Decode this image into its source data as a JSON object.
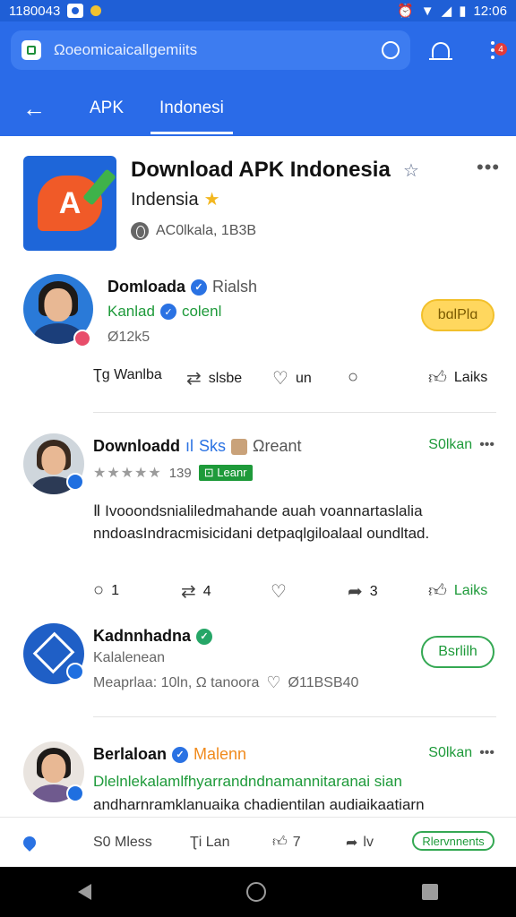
{
  "status_bar": {
    "time_left": "1180043",
    "time_right": "12:06"
  },
  "header": {
    "search_text": "Ωoeomicaicallgemiits",
    "notification_count": "4",
    "tabs": [
      {
        "label": "APK"
      },
      {
        "label": "Indonesi"
      }
    ]
  },
  "app": {
    "title": "Download APK Indonesia",
    "subtitle": "Indensia",
    "meta": "ΑC0lkala, 1Β3Β",
    "logo_letter": "A"
  },
  "posts": [
    {
      "name": "Domloada",
      "handle": "Rialsh",
      "sub_name": "Kanlad",
      "sub_extra": "colenl",
      "meta": "Ø12k5",
      "button": "bɑlPlɑ",
      "actions": {
        "a1": "Ʈg Wanlba",
        "a2": "slsbe",
        "a3": "un",
        "a5": "Laiks"
      }
    },
    {
      "name": "Downloadd",
      "extra1": "Sks",
      "extra2": "Ωreant",
      "right": "S0lkan",
      "rating_count": "139",
      "tag": "Leanr",
      "body": "Ⅱ Ivooondsnialiledmahande auah voannartaslalia nndoasIndracmisicidani detpaqlgiloalaal oundltad.",
      "actions": {
        "c1": "1",
        "c2": "4",
        "c4": "3",
        "c5": "Laiks"
      }
    },
    {
      "name": "Kadnnhadna",
      "sub": "Kalalenean",
      "meta": "Meaprlaa: 10ln, Ω tanoora",
      "meta_count": "Ø11ΒSΒ40",
      "button": "Bsrlilh"
    },
    {
      "name": "Berlaloan",
      "extra": "Malenn",
      "right": "S0lkan",
      "body_green": "Dlelnlekalamlfhyarrandndnamannitaranai sian",
      "body": "andharnramklanuaika chadientilan audiaikaatiarn"
    }
  ],
  "bottom_strip": {
    "b1": "S0 Mless",
    "b2": "Ʈi Lan",
    "b3": "7",
    "b4": "lv",
    "b5": "Rlervnnents"
  }
}
